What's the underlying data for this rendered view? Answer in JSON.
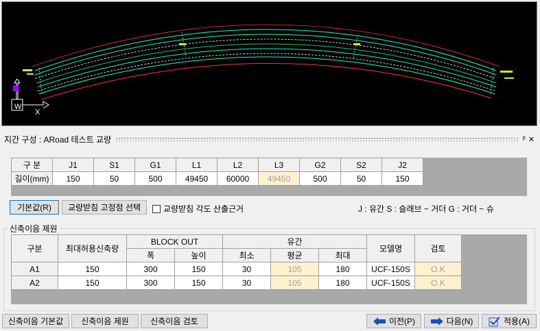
{
  "panel": {
    "title": "지간 구성 : ARoad 테스트 교량",
    "pin": "ᵖ",
    "close": "✕"
  },
  "span_table": {
    "header": [
      "구 분",
      "J1",
      "S1",
      "G1",
      "L1",
      "L2",
      "L3",
      "G2",
      "S2",
      "J2"
    ],
    "row_label": "길이(mm)",
    "values": [
      "150",
      "50",
      "500",
      "49450",
      "60000",
      "49450",
      "500",
      "50",
      "150"
    ]
  },
  "buttons": {
    "default_value": "기본값(R)",
    "bearing_select": "교량받침 고정점 선택",
    "bearing_angle": "교량받침 각도 산출근거",
    "jt_default": "신축이음 기본값",
    "jt_spec": "신축이음 제원",
    "jt_check": "신축이음 검토",
    "prev": "이전(P)",
    "next": "다음(N)",
    "apply": "적용(A)"
  },
  "legend": "J : 유간    S : 슬래브 ~ 거더    G : 거더 ~ 슈",
  "joint_group": {
    "title": "신축이음 제원",
    "h_gubun": "구분",
    "h_max": "최대허용신축량",
    "h_block": "BLOCK OUT",
    "h_width": "폭",
    "h_height": "높이",
    "h_gap": "유간",
    "h_min": "최소",
    "h_avg": "평균",
    "h_gmax": "최대",
    "h_model": "모델명",
    "h_check": "검토",
    "rows": [
      {
        "name": "A1",
        "max": "150",
        "w": "300",
        "h": "150",
        "min": "30",
        "avg": "105",
        "gmax": "180",
        "model": "UCF-150S",
        "check": "O.K"
      },
      {
        "name": "A2",
        "max": "150",
        "w": "300",
        "h": "150",
        "min": "30",
        "avg": "105",
        "gmax": "180",
        "model": "UCF-150S",
        "check": "O.K"
      }
    ]
  },
  "axis": {
    "y": "W",
    "x": "X"
  },
  "colors": {
    "viewport_bg": "#000000",
    "girder": "#00ffcc",
    "edge": "#ff3333",
    "highlight": "#fdf1cf"
  }
}
